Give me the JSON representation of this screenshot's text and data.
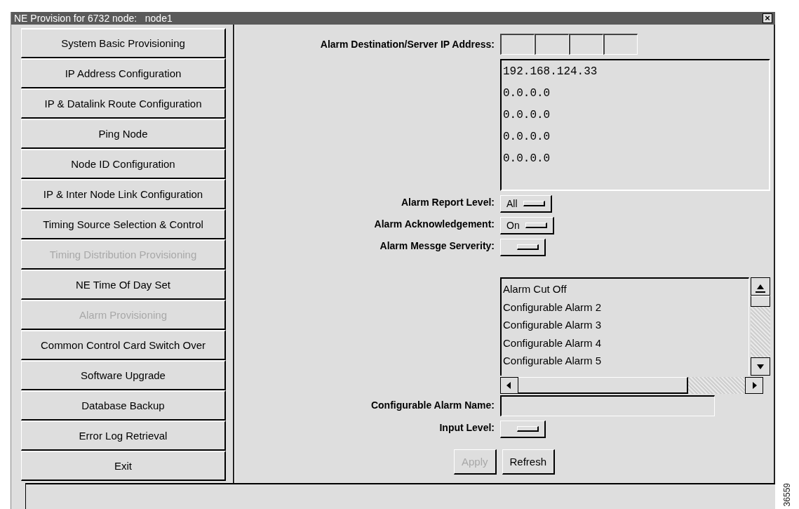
{
  "window": {
    "title": "NE Provision for 6732 node:   node1",
    "close": "×"
  },
  "sidebar": {
    "items": [
      {
        "label": "System Basic Provisioning",
        "disabled": false
      },
      {
        "label": "IP Address Configuration",
        "disabled": false
      },
      {
        "label": "IP & Datalink Route Configuration",
        "disabled": false
      },
      {
        "label": "Ping Node",
        "disabled": false
      },
      {
        "label": "Node ID Configuration",
        "disabled": false
      },
      {
        "label": "IP & Inter Node Link Configuration",
        "disabled": false
      },
      {
        "label": "Timing Source Selection & Control",
        "disabled": false
      },
      {
        "label": "Timing Distribution Provisioning",
        "disabled": true
      },
      {
        "label": "NE Time Of Day Set",
        "disabled": false
      },
      {
        "label": "Alarm Provisioning",
        "disabled": true
      },
      {
        "label": "Common Control Card Switch Over",
        "disabled": false
      },
      {
        "label": "Software Upgrade",
        "disabled": false
      },
      {
        "label": "Database Backup",
        "disabled": false
      },
      {
        "label": "Error Log Retrieval",
        "disabled": false
      },
      {
        "label": "Exit",
        "disabled": false
      }
    ]
  },
  "form": {
    "ip_label": "Alarm Destination/Server IP Address:",
    "ip_addresses": [
      "192.168.124.33",
      "0.0.0.0",
      "0.0.0.0",
      "0.0.0.0",
      "0.0.0.0"
    ],
    "options": [
      {
        "label": "Alarm Report Level:",
        "value": "All"
      },
      {
        "label": "Alarm Acknowledgement:",
        "value": "On"
      },
      {
        "label": "Alarm Messge Serverity:"
      }
    ],
    "alarms": [
      "Alarm Cut Off",
      "Configurable Alarm 2",
      "Configurable Alarm 3",
      "Configurable Alarm 4",
      "Configurable Alarm 5"
    ],
    "name_label": "Configurable Alarm Name:",
    "input_level_label": "Input Level:",
    "buttons": [
      {
        "label": "Apply",
        "disabled": true
      },
      {
        "label": "Refresh",
        "disabled": false
      }
    ]
  },
  "figure_id": "36559"
}
